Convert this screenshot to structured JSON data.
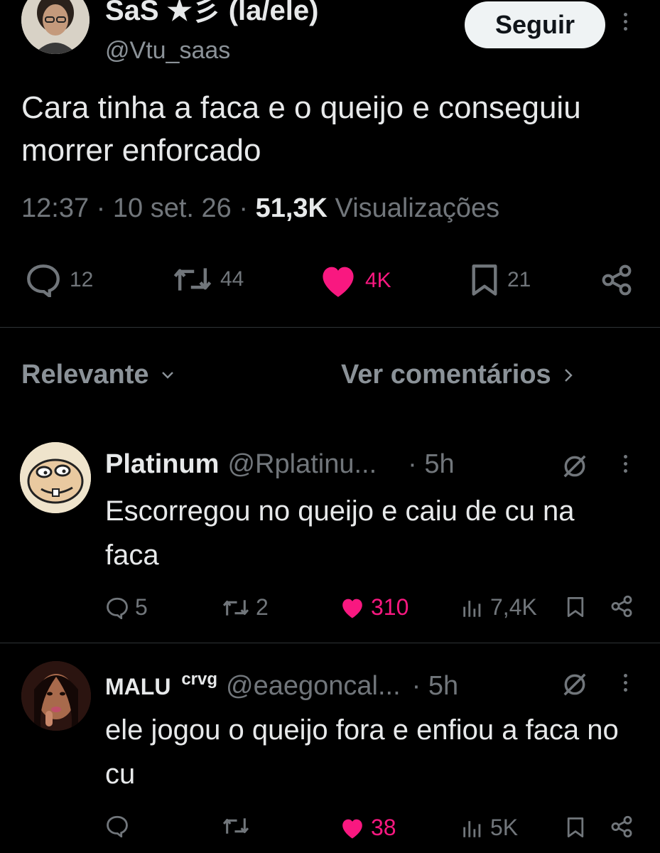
{
  "tweet": {
    "author_name": "SaS ★彡 (la/ele)",
    "author_handle": "@Vtu_saas",
    "follow_label": "Seguir",
    "text": "Cara tinha a faca e o queijo e conseguiu morrer enforcado",
    "time": "12:37",
    "date": "10 set. 26",
    "views_count": "51,3K",
    "views_label": "Visualizações",
    "actions": {
      "replies": "12",
      "reposts": "44",
      "likes": "4K",
      "bookmarks": "21"
    }
  },
  "replies_bar": {
    "sort_label": "Relevante",
    "see_comments_label": "Ver comentários"
  },
  "replies": [
    {
      "name": "Platinum",
      "handle": "@Rplatinu...",
      "time": "· 5h",
      "text": "Escorregou no queijo e caiu de cu na faca",
      "replies": "5",
      "reposts": "2",
      "likes": "310",
      "views": "7,4K"
    },
    {
      "name": "MALU",
      "name_suffix": "crvg",
      "handle": "@eaegoncal...",
      "time": "· 5h",
      "text": "ele jogou o queijo fora e enfiou a faca no cu",
      "replies": "",
      "reposts": "",
      "likes": "38",
      "views": "5K"
    }
  ],
  "colors": {
    "background": "#000000",
    "text_primary": "#e7e9ea",
    "text_secondary": "#71767b",
    "like_pink": "#f91880",
    "divider": "#2f3336"
  }
}
